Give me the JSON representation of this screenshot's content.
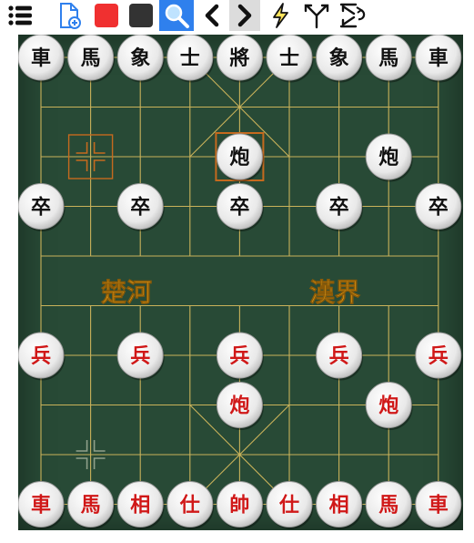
{
  "toolbar": {
    "buttons": [
      {
        "name": "menu-icon",
        "kind": "menu"
      },
      {
        "name": "new-game-icon",
        "kind": "newdoc"
      },
      {
        "name": "red-side-icon",
        "kind": "square",
        "color": "#f03030"
      },
      {
        "name": "black-side-icon",
        "kind": "square",
        "color": "#333333"
      },
      {
        "name": "search-icon",
        "kind": "search",
        "active": true
      },
      {
        "name": "chevron-left-icon",
        "kind": "chev-left"
      },
      {
        "name": "chevron-right-icon",
        "kind": "chev-right",
        "shaded": true
      },
      {
        "name": "lightning-icon",
        "kind": "bolt"
      },
      {
        "name": "branch-icon",
        "kind": "branch"
      },
      {
        "name": "flip-board-icon",
        "kind": "flip"
      }
    ]
  },
  "board": {
    "river_left": "楚河",
    "river_right": "漢界",
    "colors": {
      "felt": "#284a36",
      "line": "#c9b25a",
      "river_text": "#e8a31a",
      "red_piece": "#d01818",
      "black_piece": "#111111",
      "highlight": "#c56a1e"
    },
    "last_move": {
      "from": [
        1,
        2
      ],
      "to": [
        4,
        2
      ]
    },
    "markers": [
      [
        1,
        8
      ]
    ],
    "pieces": [
      {
        "label": "車",
        "side": "black",
        "col": 0,
        "row": 0
      },
      {
        "label": "馬",
        "side": "black",
        "col": 1,
        "row": 0
      },
      {
        "label": "象",
        "side": "black",
        "col": 2,
        "row": 0
      },
      {
        "label": "士",
        "side": "black",
        "col": 3,
        "row": 0
      },
      {
        "label": "將",
        "side": "black",
        "col": 4,
        "row": 0
      },
      {
        "label": "士",
        "side": "black",
        "col": 5,
        "row": 0
      },
      {
        "label": "象",
        "side": "black",
        "col": 6,
        "row": 0
      },
      {
        "label": "馬",
        "side": "black",
        "col": 7,
        "row": 0
      },
      {
        "label": "車",
        "side": "black",
        "col": 8,
        "row": 0
      },
      {
        "label": "炮",
        "side": "black",
        "col": 4,
        "row": 2
      },
      {
        "label": "炮",
        "side": "black",
        "col": 7,
        "row": 2
      },
      {
        "label": "卒",
        "side": "black",
        "col": 0,
        "row": 3
      },
      {
        "label": "卒",
        "side": "black",
        "col": 2,
        "row": 3
      },
      {
        "label": "卒",
        "side": "black",
        "col": 4,
        "row": 3
      },
      {
        "label": "卒",
        "side": "black",
        "col": 6,
        "row": 3
      },
      {
        "label": "卒",
        "side": "black",
        "col": 8,
        "row": 3
      },
      {
        "label": "兵",
        "side": "red",
        "col": 0,
        "row": 6
      },
      {
        "label": "兵",
        "side": "red",
        "col": 2,
        "row": 6
      },
      {
        "label": "兵",
        "side": "red",
        "col": 4,
        "row": 6
      },
      {
        "label": "兵",
        "side": "red",
        "col": 6,
        "row": 6
      },
      {
        "label": "兵",
        "side": "red",
        "col": 8,
        "row": 6
      },
      {
        "label": "炮",
        "side": "red",
        "col": 4,
        "row": 7
      },
      {
        "label": "炮",
        "side": "red",
        "col": 7,
        "row": 7
      },
      {
        "label": "車",
        "side": "red",
        "col": 0,
        "row": 9
      },
      {
        "label": "馬",
        "side": "red",
        "col": 1,
        "row": 9
      },
      {
        "label": "相",
        "side": "red",
        "col": 2,
        "row": 9
      },
      {
        "label": "仕",
        "side": "red",
        "col": 3,
        "row": 9
      },
      {
        "label": "帥",
        "side": "red",
        "col": 4,
        "row": 9
      },
      {
        "label": "仕",
        "side": "red",
        "col": 5,
        "row": 9
      },
      {
        "label": "相",
        "side": "red",
        "col": 6,
        "row": 9
      },
      {
        "label": "馬",
        "side": "red",
        "col": 7,
        "row": 9
      },
      {
        "label": "車",
        "side": "red",
        "col": 8,
        "row": 9
      }
    ]
  }
}
